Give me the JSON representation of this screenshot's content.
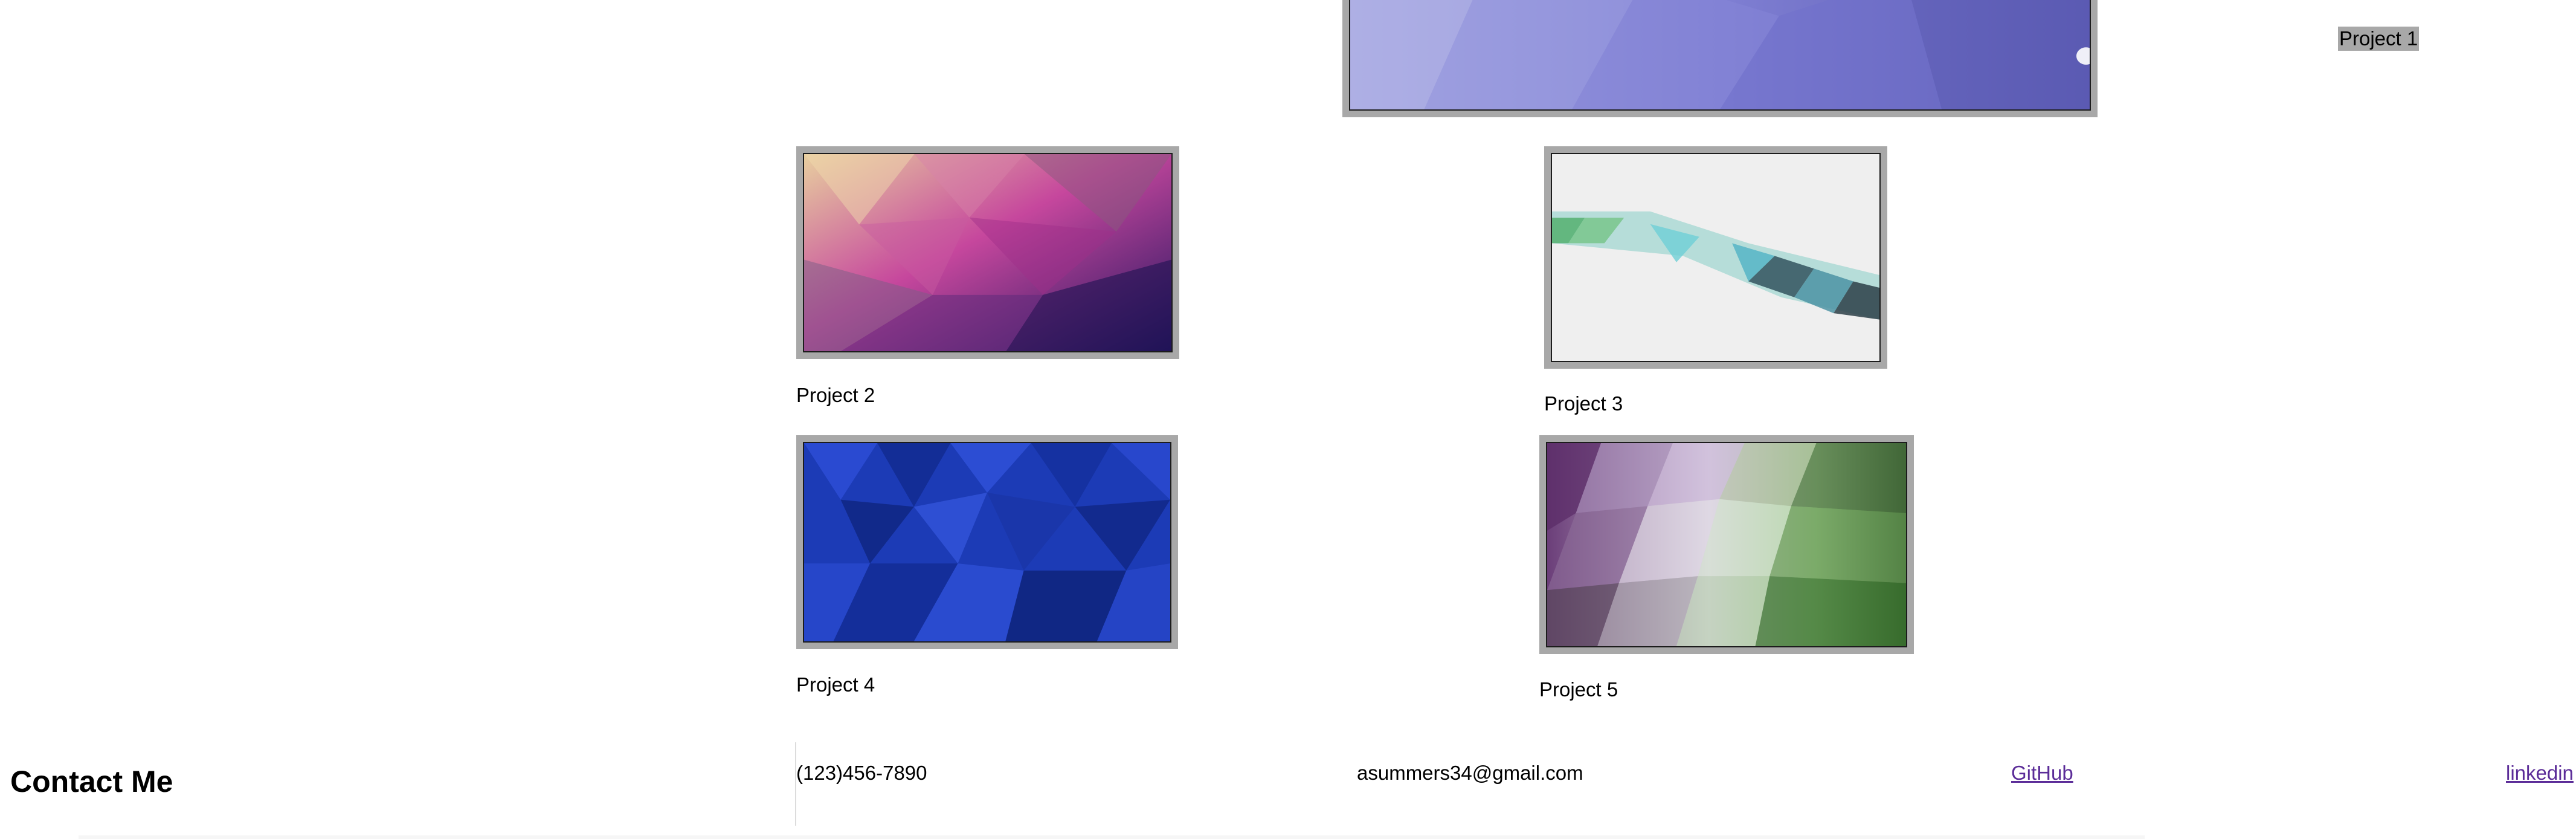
{
  "projects": [
    {
      "label": "Project 1"
    },
    {
      "label": "Project 2"
    },
    {
      "label": "Project 3"
    },
    {
      "label": "Project 4"
    },
    {
      "label": "Project 5"
    }
  ],
  "contact": {
    "heading": "Contact Me",
    "phone": "(123)456-7890",
    "email": "asummers34@gmail.com",
    "github": "GitHub",
    "linkedin": "linkedin"
  },
  "colors": {
    "frame": "#a8a8a8",
    "link_visited": "#5b2c98"
  }
}
